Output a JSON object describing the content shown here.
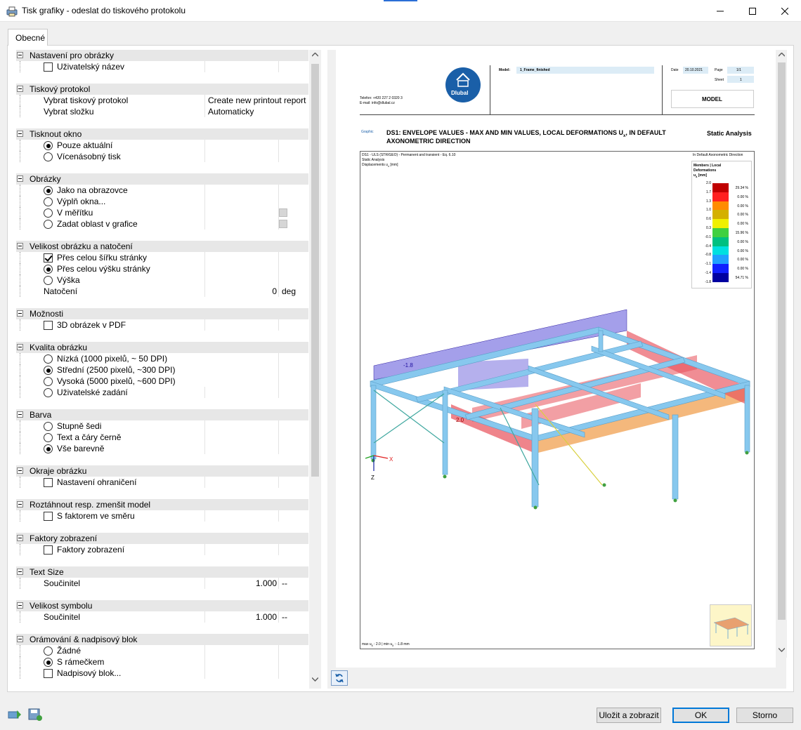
{
  "window": {
    "title": "Tisk grafiky - odeslat do tiskového protokolu"
  },
  "tabs": [
    {
      "label": "Obecné"
    }
  ],
  "sections": {
    "s1": {
      "title": "Nastavení pro obrázky",
      "user_name": "Uživatelský název"
    },
    "s2": {
      "title": "Tiskový protokol",
      "select_report_label": "Vybrat tiskový protokol",
      "select_report_value": "Create new printout report",
      "select_folder_label": "Vybrat složku",
      "select_folder_value": "Automaticky"
    },
    "s3": {
      "title": "Tisknout okno",
      "current_only": "Pouze aktuální",
      "multiple": "Vícenásobný tisk"
    },
    "s4": {
      "title": "Obrázky",
      "as_screen": "Jako na obrazovce",
      "fill_window": "Výplň okna...",
      "to_scale": "V měřítku",
      "area": "Zadat oblast v grafice"
    },
    "s5": {
      "title": "Velikost obrázku a natočení",
      "full_width": "Přes celou šířku stránky",
      "full_height": "Přes celou výšku stránky",
      "height": "Výška",
      "rotation_label": "Natočení",
      "rotation_value": "0",
      "rotation_unit": "deg"
    },
    "s6": {
      "title": "Možnosti",
      "pdf3d": "3D obrázek v PDF"
    },
    "s7": {
      "title": "Kvalita obrázku",
      "low": "Nízká (1000 pixelů, ~ 50 DPI)",
      "medium": "Střední (2500 pixelů, ~300 DPI)",
      "high": "Vysoká (5000 pixelů, ~600 DPI)",
      "user": "Uživatelské zadání"
    },
    "s8": {
      "title": "Barva",
      "gray": "Stupně šedi",
      "bw": "Text a čáry černě",
      "color": "Vše barevně"
    },
    "s9": {
      "title": "Okraje obrázku",
      "margins": "Nastavení ohraničení"
    },
    "s10": {
      "title": "Roztáhnout resp. zmenšit model",
      "factor": "S faktorem ve směru"
    },
    "s11": {
      "title": "Faktory zobrazení",
      "factors": "Faktory zobrazení"
    },
    "s12": {
      "title": "Text Size",
      "label": "Součinitel",
      "value": "1.000",
      "unit": "--"
    },
    "s13": {
      "title": "Velikost symbolu",
      "label": "Součinitel",
      "value": "1.000",
      "unit": "--"
    },
    "s14": {
      "title": "Orámování & nadpisový blok",
      "none": "Žádné",
      "frame": "S rámečkem",
      "title_block": "Nadpisový blok..."
    }
  },
  "preview": {
    "phone": "Telefon: +420 227 2 0320 3",
    "email": "E-mail: info@dlubal.cz",
    "logo": "Dlubal",
    "model_label": "Model:",
    "model_value": "1_Frame_finished",
    "date_label": "Date",
    "date_value": "20.10.2021",
    "page_label": "Page",
    "page_value": "1/1",
    "sheet_label": "Sheet",
    "sheet_value": "1",
    "model_box": "MODEL",
    "graphic_label": "Graphic",
    "heading_line1": "DS1: ENVELOPE VALUES - MAX AND MIN VALUES, LOCAL DEFORMATIONS U",
    "heading_sub": "x",
    "heading_line1_end": ", IN DEFAULT",
    "heading_line2": "AXONOMETRIC DIRECTION",
    "static_analysis": "Static Analysis",
    "info_line1": "DS1 - ULS (STR/GEO) - Permanent and transient - Eq. 6.10",
    "info_line2": "Static Analysis",
    "info_line3": "Displacements u",
    "info_line3_end": " [mm]",
    "direction": "In Default Axonometric Direction",
    "legend_title1": "Members | Local",
    "legend_title2": "Deformations",
    "legend_title3": "u",
    "legend_title3_end": " [mm]",
    "label_min": "-1.8",
    "label_max": "2.0",
    "axis_x": "X",
    "axis_z": "Z",
    "footer": "max u",
    "footer_mid": " : 2.0 | min u",
    "footer_end": " : -1.8 mm"
  },
  "legend": {
    "values": [
      "2.0",
      "1.7",
      "1.3",
      "1.0",
      "0.6",
      "0.3",
      "-0.1",
      "-0.4",
      "-0.8",
      "-1.1",
      "-1.4",
      "-1.8"
    ],
    "percents": [
      "29.34 %",
      "0.00 %",
      "0.00 %",
      "0.00 %",
      "0.00 %",
      "15.96 %",
      "0.00 %",
      "0.00 %",
      "0.00 %",
      "0.00 %",
      "54.71 %"
    ],
    "colors": [
      "#c00000",
      "#ff2020",
      "#ff8c00",
      "#d4b000",
      "#f0f000",
      "#40d040",
      "#00c080",
      "#00e0e0",
      "#20a0ff",
      "#1020ff",
      "#0000a0"
    ]
  },
  "buttons": {
    "save_show": "Uložit a zobrazit",
    "ok": "OK",
    "cancel": "Storno"
  },
  "colors": {
    "accent": "#0078d7",
    "frame_blue": "#87c8ee",
    "diagram_red": "#e8505a",
    "diagram_blue": "#5a50d8"
  }
}
